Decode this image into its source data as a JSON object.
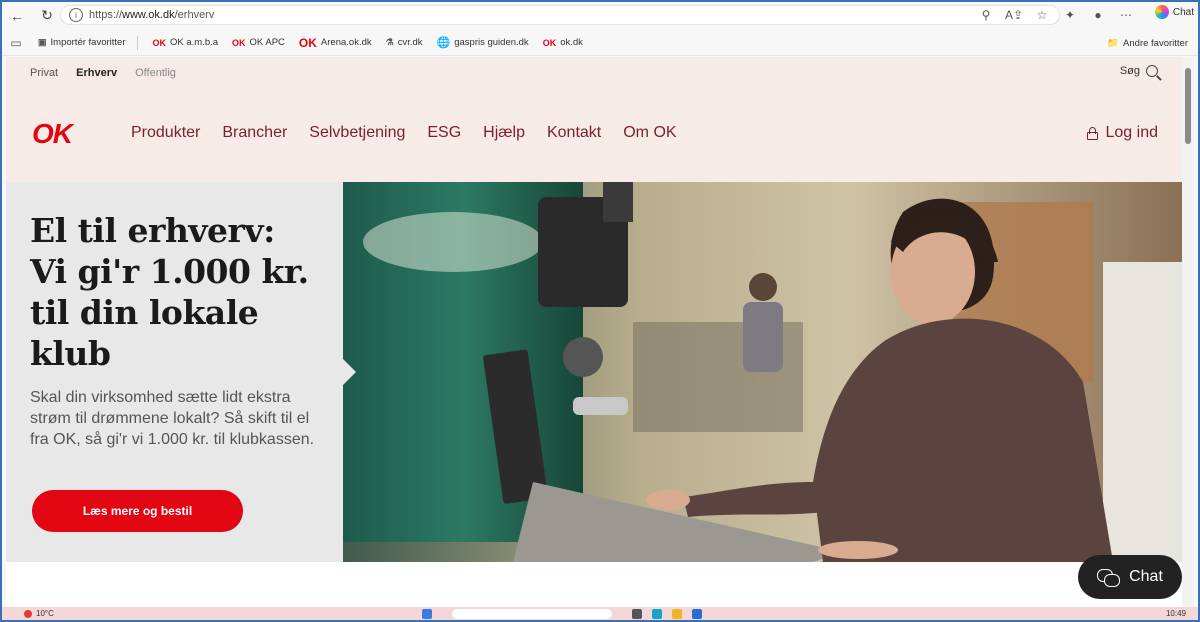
{
  "browser": {
    "url_prefix": "https://",
    "url_host": "www.ok.dk",
    "url_path": "/erhverv",
    "chat_label": "Chat",
    "favorites": [
      {
        "label": "Importér favoritter",
        "icon": "import-icon"
      },
      {
        "label": "OK a.m.b.a",
        "icon": "ok-icon"
      },
      {
        "label": "OK APC",
        "icon": "ok-icon"
      },
      {
        "label": "Arena.ok.dk",
        "icon": "ok-icon"
      },
      {
        "label": "cvr.dk",
        "icon": "cvr-icon"
      },
      {
        "label": "gaspris guiden.dk",
        "icon": "globe-icon"
      },
      {
        "label": "ok.dk",
        "icon": "ok-icon"
      }
    ],
    "other_favorites": "Andre favoritter"
  },
  "site": {
    "segments": [
      {
        "label": "Privat",
        "active": false
      },
      {
        "label": "Erhverv",
        "active": true
      },
      {
        "label": "Offentlig",
        "active": false
      }
    ],
    "search_label": "Søg",
    "logo_text": "OK",
    "nav": [
      "Produkter",
      "Brancher",
      "Selvbetjening",
      "ESG",
      "Hjælp",
      "Kontakt",
      "Om OK"
    ],
    "login_label": "Log ind",
    "brand_color": "#e20613",
    "nav_color": "#7a1f2b"
  },
  "hero": {
    "title_lines": [
      "El til erhverv:",
      "Vi gi'r 1.000 kr.",
      "til din lokale",
      "klub"
    ],
    "body": "Skal din virksomhed sætte lidt ekstra strøm til drømmene lokalt? Så skift til el fra OK, så gi'r vi 1.000 kr. til klubkassen.",
    "cta_label": "Læs mere og bestil"
  },
  "chat_widget": {
    "label": "Chat"
  },
  "taskbar": {
    "weather": "10°C",
    "time": "10:49"
  }
}
